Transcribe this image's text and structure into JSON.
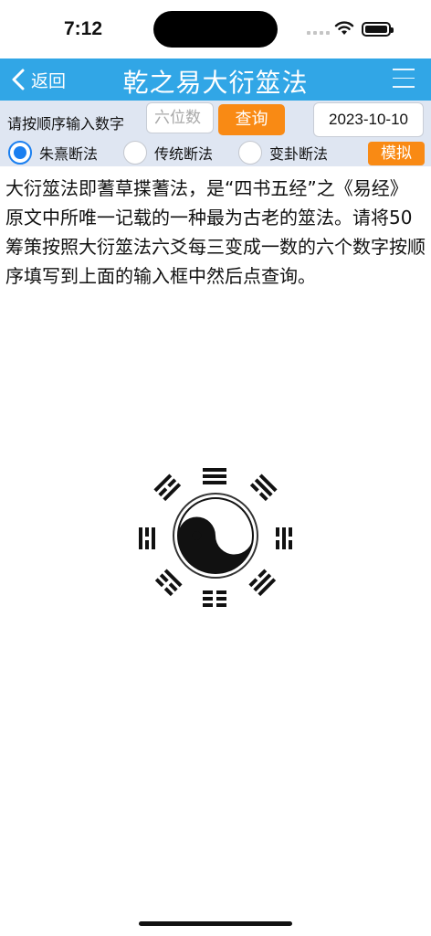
{
  "status_bar": {
    "time": "7:12"
  },
  "nav": {
    "back_label": "返回",
    "title": "乾之易大衍筮法"
  },
  "query": {
    "label": "请按顺序输入数字",
    "input_placeholder": "六位数",
    "input_value": "",
    "button_label": "查询",
    "date": "2023-10-10"
  },
  "methods": [
    {
      "label": "朱熹断法",
      "selected": true
    },
    {
      "label": "传统断法",
      "selected": false
    },
    {
      "label": "变卦断法",
      "selected": false
    }
  ],
  "simulate_label": "模拟",
  "description": "大衍筮法即蓍草揲蓍法，是“四书五经”之《易经》原文中所唯一记载的一种最为古老的筮法。请将50筹策按照大衍筮法六爻每三变成一数的六个数字按顺序填写到上面的输入框中然后点查询。",
  "icons": {
    "back": "chevron-left-icon",
    "menu": "menu-icon",
    "wifi": "wifi-icon",
    "battery": "battery-icon",
    "emblem": "bagua-taiji-emblem"
  },
  "colors": {
    "nav_bar": "#31a6e6",
    "toolbar": "#dfe6f2",
    "accent_button": "#f98a14",
    "radio_selected": "#1a7ff0"
  }
}
